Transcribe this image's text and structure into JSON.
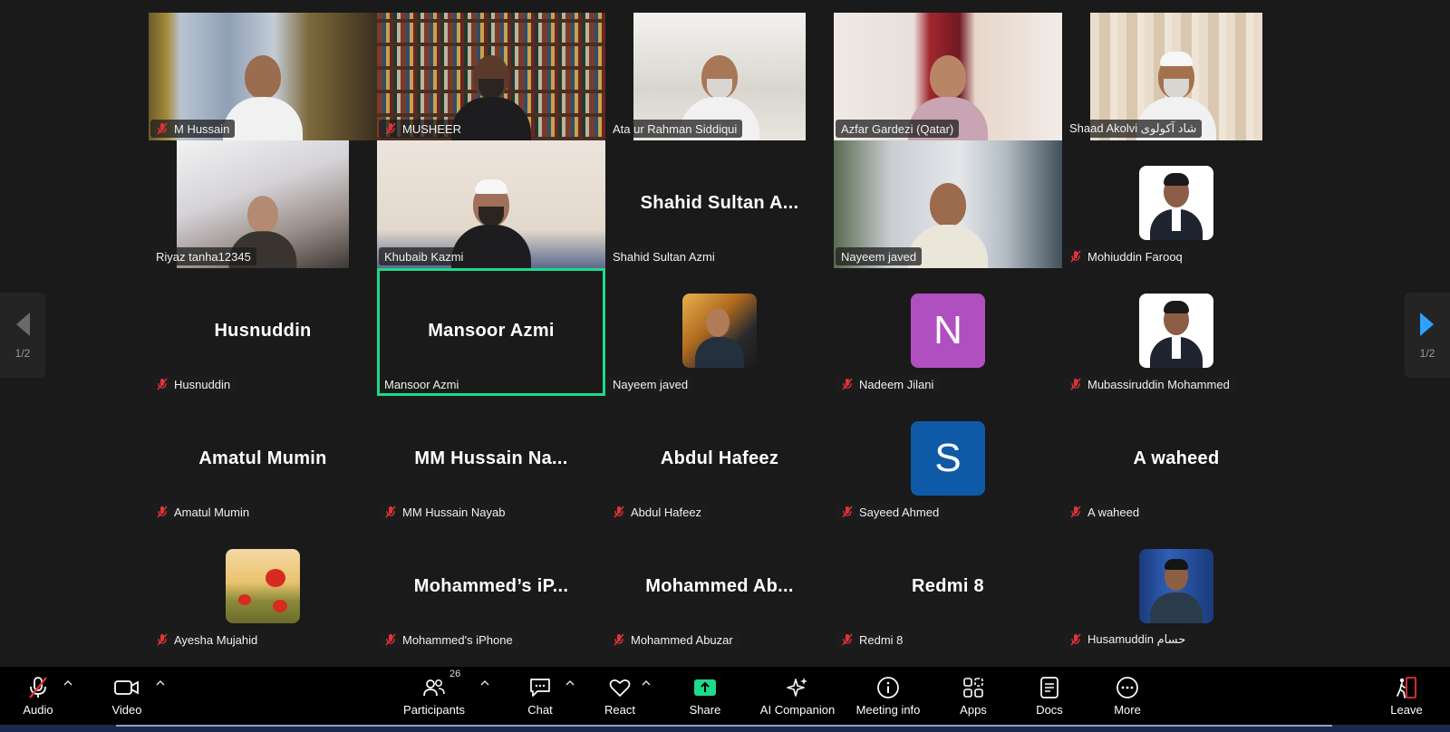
{
  "pager": {
    "page_label": "1/2"
  },
  "tiles": [
    {
      "label": "M Hussain",
      "muted": true
    },
    {
      "label": "MUSHEER",
      "muted": true
    },
    {
      "label": "Ata ur Rahman Siddiqui",
      "muted": false
    },
    {
      "label": "Azfar Gardezi (Qatar)",
      "muted": false
    },
    {
      "label": "Shaad Akolvi  شاد آکولوی",
      "muted": false
    },
    {
      "label": "Riyaz tanha12345",
      "muted": false
    },
    {
      "label": "Khubaib Kazmi",
      "muted": false
    },
    {
      "label": "Shahid Sultan Azmi",
      "display": "Shahid Sultan A...",
      "muted": false
    },
    {
      "label": "Nayeem javed",
      "muted": false
    },
    {
      "label": "Mohiuddin Farooq",
      "muted": true
    },
    {
      "label": "Husnuddin",
      "display": "Husnuddin",
      "muted": true
    },
    {
      "label": "Mansoor Azmi",
      "display": "Mansoor Azmi",
      "muted": false,
      "active": true
    },
    {
      "label": "Nayeem javed",
      "muted": false
    },
    {
      "label": "Nadeem Jilani",
      "muted": true,
      "letter": "N",
      "color": "#b04fc0"
    },
    {
      "label": "Mubassiruddin Mohammed",
      "muted": true
    },
    {
      "label": "Amatul Mumin",
      "display": "Amatul Mumin",
      "muted": true
    },
    {
      "label": "MM Hussain Nayab",
      "display": "MM Hussain Na...",
      "muted": true
    },
    {
      "label": "Abdul Hafeez",
      "display": "Abdul Hafeez",
      "muted": true
    },
    {
      "label": "Sayeed Ahmed",
      "muted": true,
      "letter": "S",
      "color": "#0e5aa7"
    },
    {
      "label": "A waheed",
      "display": "A waheed",
      "muted": true
    },
    {
      "label": "Ayesha Mujahid",
      "muted": true
    },
    {
      "label": "Mohammed's iPhone",
      "display": "Mohammed’s iP...",
      "muted": true
    },
    {
      "label": "Mohammed Abuzar",
      "display": "Mohammed Ab...",
      "muted": true
    },
    {
      "label": "Redmi 8",
      "display": "Redmi 8",
      "muted": true
    },
    {
      "label": "Husamuddin حسام",
      "muted": true
    }
  ],
  "toolbar": {
    "audio": "Audio",
    "video": "Video",
    "participants": "Participants",
    "participants_count": "26",
    "chat": "Chat",
    "react": "React",
    "share": "Share",
    "ai_companion": "AI Companion",
    "meeting_info": "Meeting info",
    "apps": "Apps",
    "docs": "Docs",
    "more": "More",
    "leave": "Leave"
  },
  "colors": {
    "active_border": "#1ed98a",
    "share_green": "#1ed98a",
    "mute_red": "#e0333b",
    "pager_arrow": "#2da1ff"
  }
}
